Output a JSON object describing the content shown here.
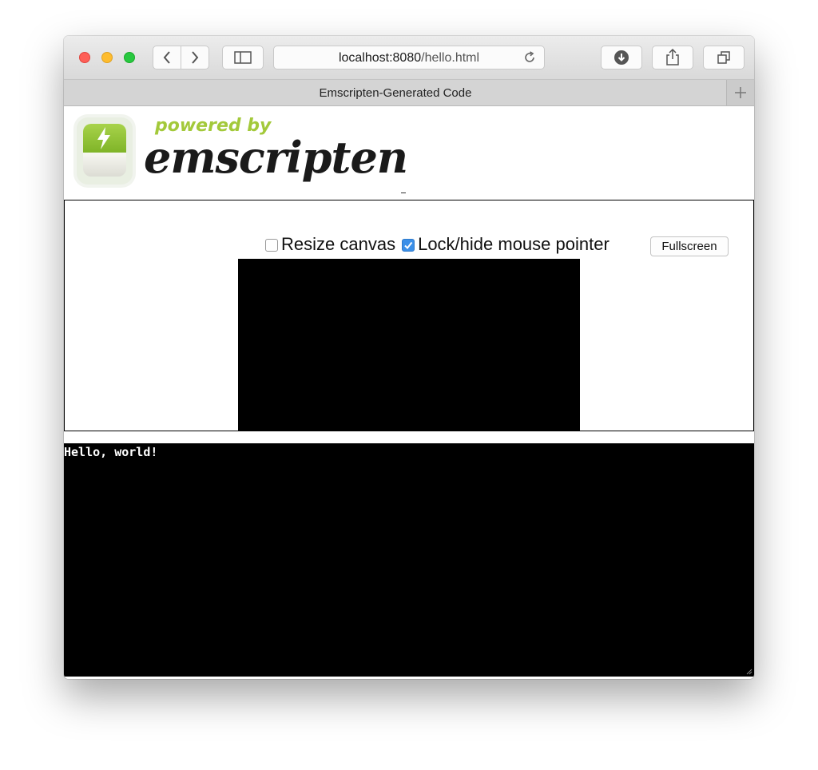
{
  "browser": {
    "url_host": "localhost:8080",
    "url_path": "/hello.html",
    "tab_title": "Emscripten-Generated Code"
  },
  "logo": {
    "tagline": "powered by",
    "wordmark": "emscripten"
  },
  "controls": {
    "resize_canvas": {
      "label": "Resize canvas",
      "checked": false
    },
    "lock_pointer": {
      "label": "Lock/hide mouse pointer",
      "checked": true
    },
    "fullscreen_label": "Fullscreen"
  },
  "output": {
    "text": "Hello, world!"
  },
  "colors": {
    "close": "#fe5f57",
    "minimize": "#febc2e",
    "zoom": "#28c840",
    "logo_green": "#a3c93a",
    "checkbox_blue": "#3b8fe8"
  },
  "icons": [
    "back-icon",
    "forward-icon",
    "sidebar-icon",
    "reload-icon",
    "download-icon",
    "share-icon",
    "tabs-icon",
    "plus-icon",
    "checkmark-icon",
    "lightning-icon",
    "resize-grip-icon"
  ]
}
